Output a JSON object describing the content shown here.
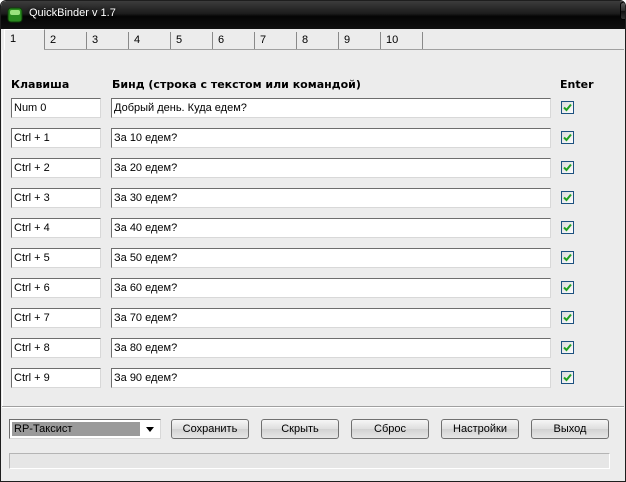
{
  "window": {
    "title": "QuickBinder v 1.7",
    "controls": {
      "minimize": "▁",
      "maximize": "□",
      "close": "✕"
    }
  },
  "tabs": [
    "1",
    "2",
    "3",
    "4",
    "5",
    "6",
    "7",
    "8",
    "9",
    "10"
  ],
  "headers": {
    "key": "Клавиша",
    "bind": "Бинд (строка с текстом или командой)",
    "enter": "Enter"
  },
  "rows": [
    {
      "key": "Num 0",
      "bind": "Добрый день. Куда едем?",
      "enter": true
    },
    {
      "key": "Ctrl + 1",
      "bind": "За 10 едем?",
      "enter": true
    },
    {
      "key": "Ctrl + 2",
      "bind": "За 20 едем?",
      "enter": true
    },
    {
      "key": "Ctrl + 3",
      "bind": "За 30 едем?",
      "enter": true
    },
    {
      "key": "Ctrl + 4",
      "bind": "За 40 едем?",
      "enter": true
    },
    {
      "key": "Ctrl + 5",
      "bind": "За 50 едем?",
      "enter": true
    },
    {
      "key": "Ctrl + 6",
      "bind": "За 60 едем?",
      "enter": true
    },
    {
      "key": "Ctrl + 7",
      "bind": "За 70 едем?",
      "enter": true
    },
    {
      "key": "Ctrl + 8",
      "bind": "За 80 едем?",
      "enter": true
    },
    {
      "key": "Ctrl + 9",
      "bind": "За 90 едем?",
      "enter": true
    }
  ],
  "profile": {
    "selected": "RP-Таксист"
  },
  "buttons": {
    "save": "Сохранить",
    "hide": "Скрыть",
    "reset": "Сброс",
    "settings": "Настройки",
    "exit": "Выход"
  },
  "colors": {
    "titlebar": "#1c1c1c",
    "check_border": "#1c5180",
    "check_mark": "#21a121"
  }
}
